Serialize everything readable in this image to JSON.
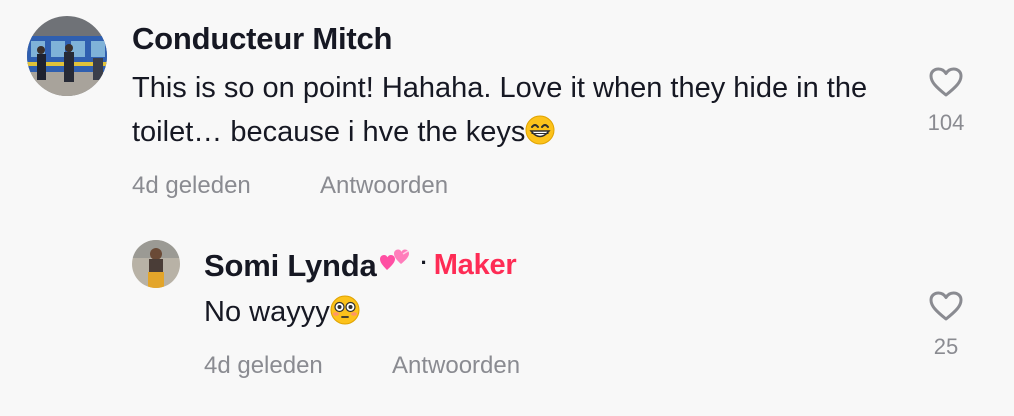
{
  "comments": [
    {
      "author": "Conducteur Mitch",
      "text": "This is so on point! Hahaha. Love it when they hide in the toilet… because i hve the keys",
      "trailing_emoji": "grinning-face-with-smiling-eyes",
      "time": "4d geleden",
      "reply_label": "Antwoorden",
      "likes": "104",
      "icon": "heart-outline-icon"
    },
    {
      "author": "Somi Lynda",
      "author_emoji": "two-hearts",
      "badge": "Maker",
      "separator": "·",
      "text": "No wayyy",
      "trailing_emoji": "flushed-face",
      "time": "4d geleden",
      "reply_label": "Antwoorden",
      "likes": "25",
      "icon": "heart-outline-icon"
    }
  ],
  "colors": {
    "background": "#f8f8f8",
    "text": "#161823",
    "secondary": "#8a8b91",
    "creator_badge": "#fe2c55"
  }
}
